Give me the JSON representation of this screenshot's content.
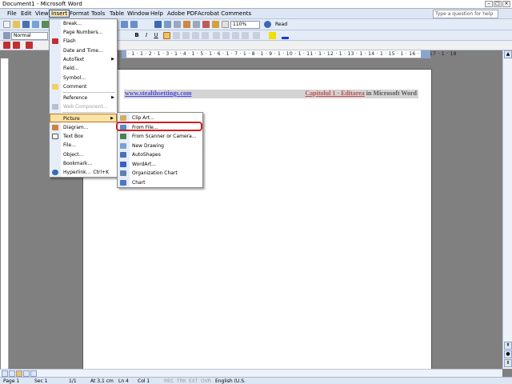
{
  "window": {
    "title": "Document1 - Microsoft Word"
  },
  "menubar": {
    "items": [
      "File",
      "Edit",
      "View",
      "Insert",
      "Format",
      "Tools",
      "Table",
      "Window",
      "Help",
      "Adobe PDF",
      "Acrobat Comments"
    ],
    "help_placeholder": "Type a question for help"
  },
  "toolbar": {
    "style": "Normal",
    "zoom": "110%",
    "read_label": "Read",
    "bold": "B",
    "italic": "I",
    "underline": "U"
  },
  "ruler": {
    "ticks": "· 1 · 1 · 2 · 1 · 3 · 1 · 4 · 1 · 5 · 1 · 6 · 1 · 7 · 1 · 8 · 1 · 9 · 1 · 10 · 1 · 11 · 1 · 12 · 1 · 13 · 1 · 14 · 1 · 15 · 1 · 16 · 1 · 17 · 1 · 18"
  },
  "document": {
    "header_left": "www.stealthsettings.com",
    "header_right_1": "Capitolul 1",
    "header_right_2": " - ",
    "header_right_3": "Editarea",
    "header_right_4": " in Microsoft Word"
  },
  "insert_menu": {
    "items": [
      {
        "label": "Break..."
      },
      {
        "label": "Page Numbers..."
      },
      {
        "label": "Flash"
      },
      {
        "label": "Date and Time..."
      },
      {
        "label": "AutoText",
        "submenu": true
      },
      {
        "label": "Field..."
      },
      {
        "label": "Symbol..."
      },
      {
        "label": "Comment"
      },
      {
        "label": "Reference",
        "submenu": true
      },
      {
        "label": "Web Component...",
        "disabled": true
      },
      {
        "label": "Picture",
        "submenu": true,
        "highlighted": true
      },
      {
        "label": "Diagram..."
      },
      {
        "label": "Text Box"
      },
      {
        "label": "File..."
      },
      {
        "label": "Object..."
      },
      {
        "label": "Bookmark..."
      },
      {
        "label": "Hyperlink...",
        "shortcut": "Ctrl+K"
      }
    ]
  },
  "picture_menu": {
    "items": [
      {
        "label": "Clip Art..."
      },
      {
        "label": "From File...",
        "circled": true
      },
      {
        "label": "From Scanner or Camera..."
      },
      {
        "label": "New Drawing"
      },
      {
        "label": "AutoShapes"
      },
      {
        "label": "WordArt..."
      },
      {
        "label": "Organization Chart"
      },
      {
        "label": "Chart"
      }
    ]
  },
  "status": {
    "page": "Page 1",
    "sec": "Sec 1",
    "pages": "1/1",
    "at": "At 3,1 cm",
    "ln": "Ln 4",
    "col": "Col 1",
    "rec": "REC",
    "trk": "TRK",
    "ext": "EXT",
    "ovr": "OVR",
    "lang": "English (U.S."
  }
}
